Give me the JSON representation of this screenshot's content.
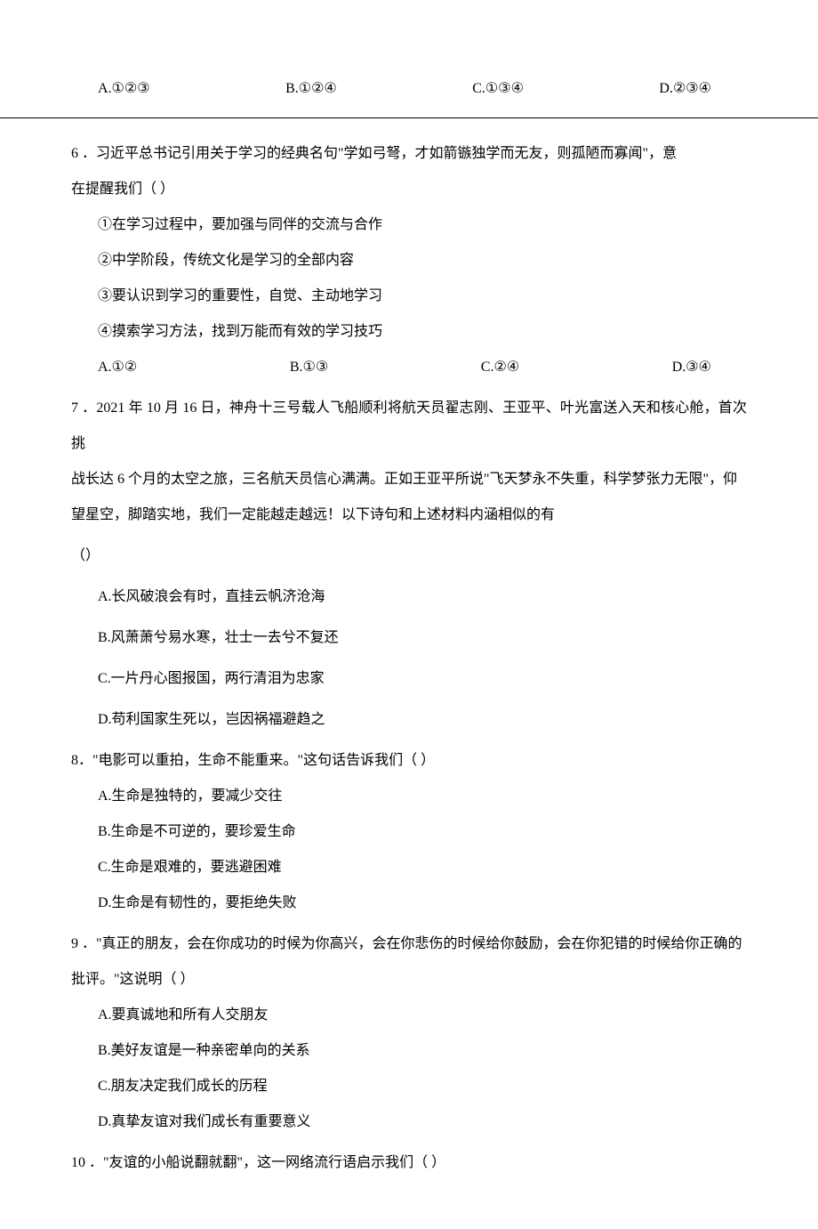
{
  "top_options": {
    "A": "A.①②③",
    "B": "B.①②④",
    "C": "C.①③④",
    "D": "D.②③④"
  },
  "q6": {
    "stem_a": "6 ．习近平总书记引用关于学习的经典名句\"学如弓弩，才如箭镞独学而无友，则孤陋而寡闻\"，意",
    "stem_b": "在提醒我们（        ）",
    "s1": "①在学习过程中，要加强与同伴的交流与合作",
    "s2": "②中学阶段，传统文化是学习的全部内容",
    "s3": "③要认识到学习的重要性，自觉、主动地学习",
    "s4": "④摸索学习方法，找到万能而有效的学习技巧",
    "opts": {
      "A": "A.①②",
      "B": "B.①③",
      "C": "C.②④",
      "D": "D.③④"
    }
  },
  "q7": {
    "stem_a": "7 ．2021 年 10 月 16 日，神舟十三号载人飞船顺利将航天员翟志刚、王亚平、叶光富送入天和核心舱，首次挑",
    "stem_b": "战长达 6 个月的太空之旅，三名航天员信心满满。正如王亚平所说\"飞天梦永不失重，科学梦张力无限\"，仰",
    "stem_c": "望星空，脚踏实地，我们一定能越走越远！以下诗句和上述材料内涵相似的有",
    "stem_d": "（）",
    "A": "A.长风破浪会有时，直挂云帆济沧海",
    "B": "B.风萧萧兮易水寒，壮士一去兮不复还",
    "C": "C.一片丹心图报国，两行清泪为忠家",
    "D": "D.苟利国家生死以，岂因祸福避趋之"
  },
  "q8": {
    "stem": "8．\"电影可以重拍，生命不能重来。\"这句话告诉我们（            ）",
    "A": "A.生命是独特的，要减少交往",
    "B": "B.生命是不可逆的，要珍爱生命",
    "C": "C.生命是艰难的，要逃避困难",
    "D": "D.生命是有韧性的，要拒绝失败"
  },
  "q9": {
    "stem_a": "9 ．\"真正的朋友，会在你成功的时候为你高兴，会在你悲伤的时候给你鼓励，会在你犯错的时候给你正确的",
    "stem_b": "批评。\"这说明（                ）",
    "A": "A.要真诚地和所有人交朋友",
    "B": "B.美好友谊是一种亲密单向的关系",
    "C": "C.朋友决定我们成长的历程",
    "D": "D.真挚友谊对我们成长有重要意义"
  },
  "q10": {
    "stem": "10 ．\"友谊的小船说翻就翻\"，这一网络流行语启示我们（        ）"
  }
}
